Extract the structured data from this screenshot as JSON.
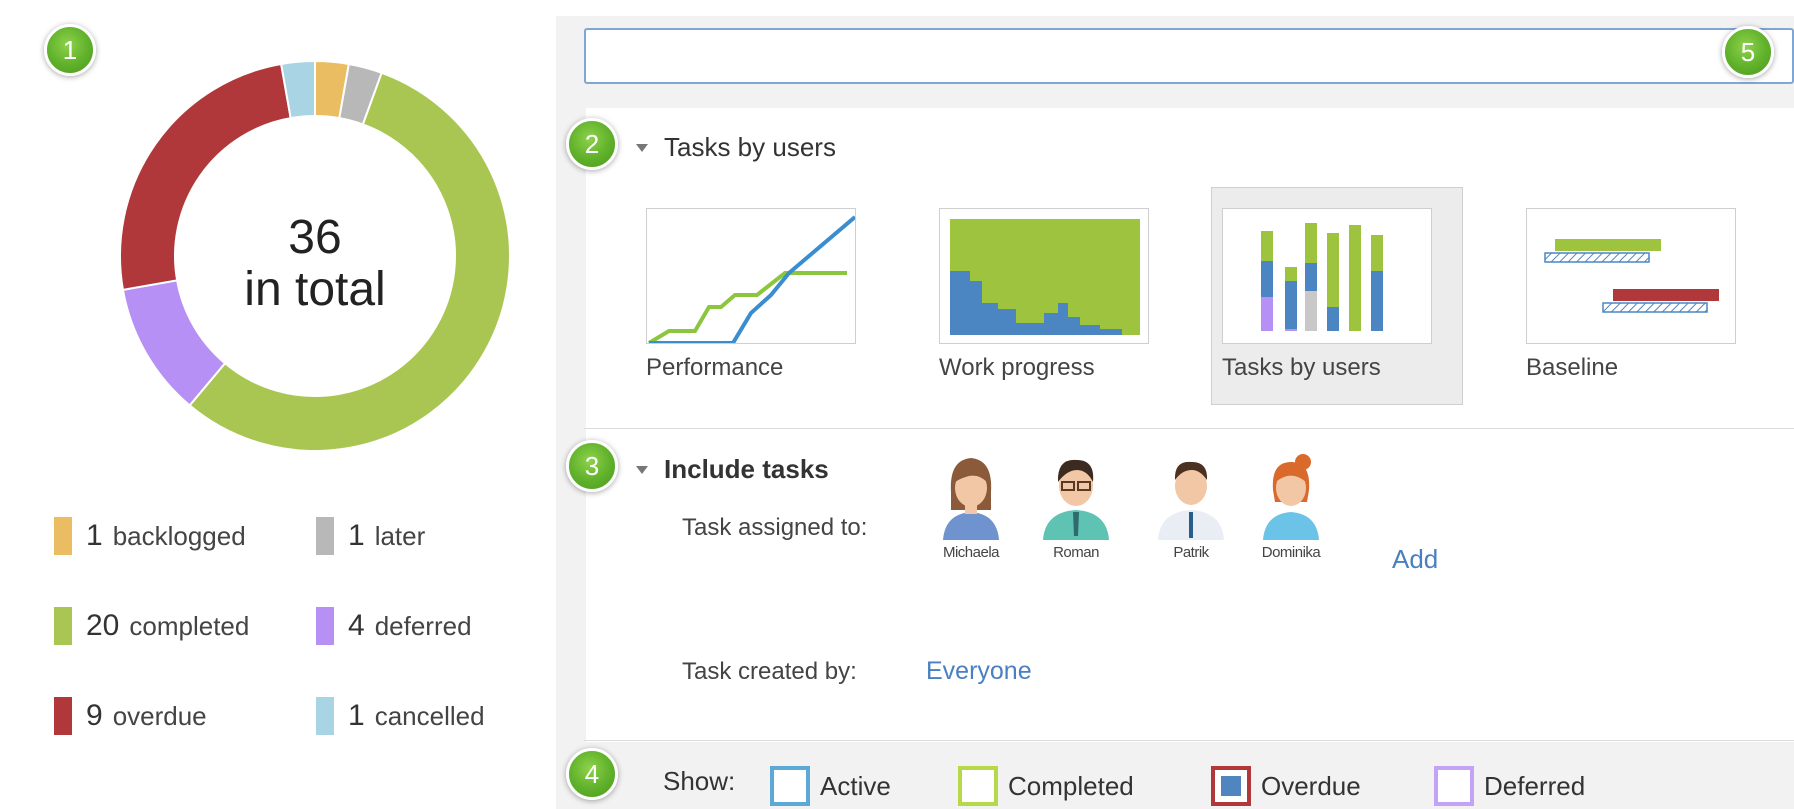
{
  "badges": {
    "b1": "1",
    "b2": "2",
    "b3": "3",
    "b4": "4",
    "b5": "5"
  },
  "summary": {
    "total_number": "36",
    "total_text": "in total",
    "legend": [
      {
        "count": "1",
        "label": "backlogged",
        "color": "#ebbd63"
      },
      {
        "count": "1",
        "label": "later",
        "color": "#b8b8b8"
      },
      {
        "count": "20",
        "label": "completed",
        "color": "#aac652"
      },
      {
        "count": "4",
        "label": "deferred",
        "color": "#b690f5"
      },
      {
        "count": "9",
        "label": "overdue",
        "color": "#b0383a"
      },
      {
        "count": "1",
        "label": "cancelled",
        "color": "#a9d4e3"
      }
    ]
  },
  "search": {
    "value": "",
    "placeholder": ""
  },
  "report_types": {
    "title": "Tasks by users",
    "charts": [
      {
        "label": "Performance"
      },
      {
        "label": "Work progress"
      },
      {
        "label": "Tasks by users",
        "selected": true
      },
      {
        "label": "Baseline"
      }
    ]
  },
  "include_tasks": {
    "title": "Include tasks",
    "assigned_label": "Task assigned to:",
    "users": [
      "Michaela",
      "Roman",
      "Patrik",
      "Dominika"
    ],
    "add_label": "Add",
    "created_label": "Task created by:",
    "created_value": "Everyone"
  },
  "show": {
    "label": "Show:",
    "options": [
      {
        "label": "Active",
        "color": "#5aa9d6",
        "fill": "#ffffff"
      },
      {
        "label": "Completed",
        "color": "#b6d94a",
        "fill": "#ffffff"
      },
      {
        "label": "Overdue",
        "color": "#b0383a",
        "fill": "#4f86c1"
      },
      {
        "label": "Deferred",
        "color": "#c2a3f7",
        "fill": "#ffffff"
      }
    ]
  }
}
